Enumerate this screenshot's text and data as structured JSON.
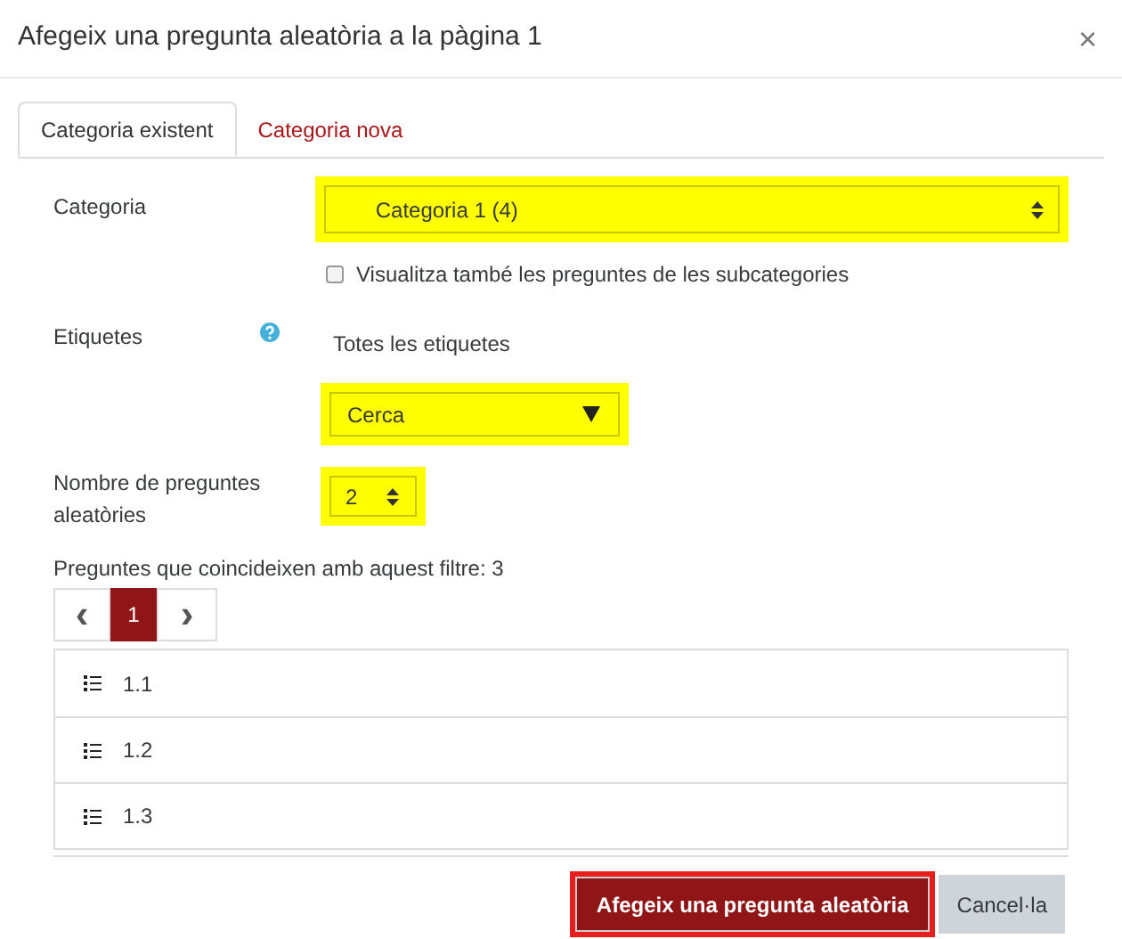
{
  "window": {
    "title": "Afegeix una pregunta aleatòria a la pàgina 1",
    "close": "×"
  },
  "tabs": [
    {
      "label": "Categoria existent",
      "selected": true
    },
    {
      "label": "Categoria nova",
      "selected": false
    }
  ],
  "category": {
    "label": "Categoria",
    "value": "Categoria 1 (4)",
    "highlighted": true
  },
  "subcategories": {
    "label": "Visualitza també les preguntes de les subcategories",
    "checked": false
  },
  "tags": {
    "label": "Etiquetes",
    "value": "Totes les etiquetes",
    "search": "Cerca",
    "highlighted": true
  },
  "count": {
    "label": "Nombre de preguntes aleatòries",
    "value": "2",
    "highlighted": true
  },
  "filter_text": "Preguntes que coincideixen amb aquest filtre: 3",
  "pagination": {
    "prev": "‹",
    "next": "›",
    "pages": [
      {
        "label": "1",
        "selected": true
      }
    ]
  },
  "questions": [
    "1.1",
    "1.2",
    "1.3"
  ],
  "buttons": [
    {
      "label": "Afegeix una pregunta aleatòria",
      "kind": "primary"
    },
    {
      "label": "Cancel·la",
      "kind": "secondary"
    }
  ]
}
